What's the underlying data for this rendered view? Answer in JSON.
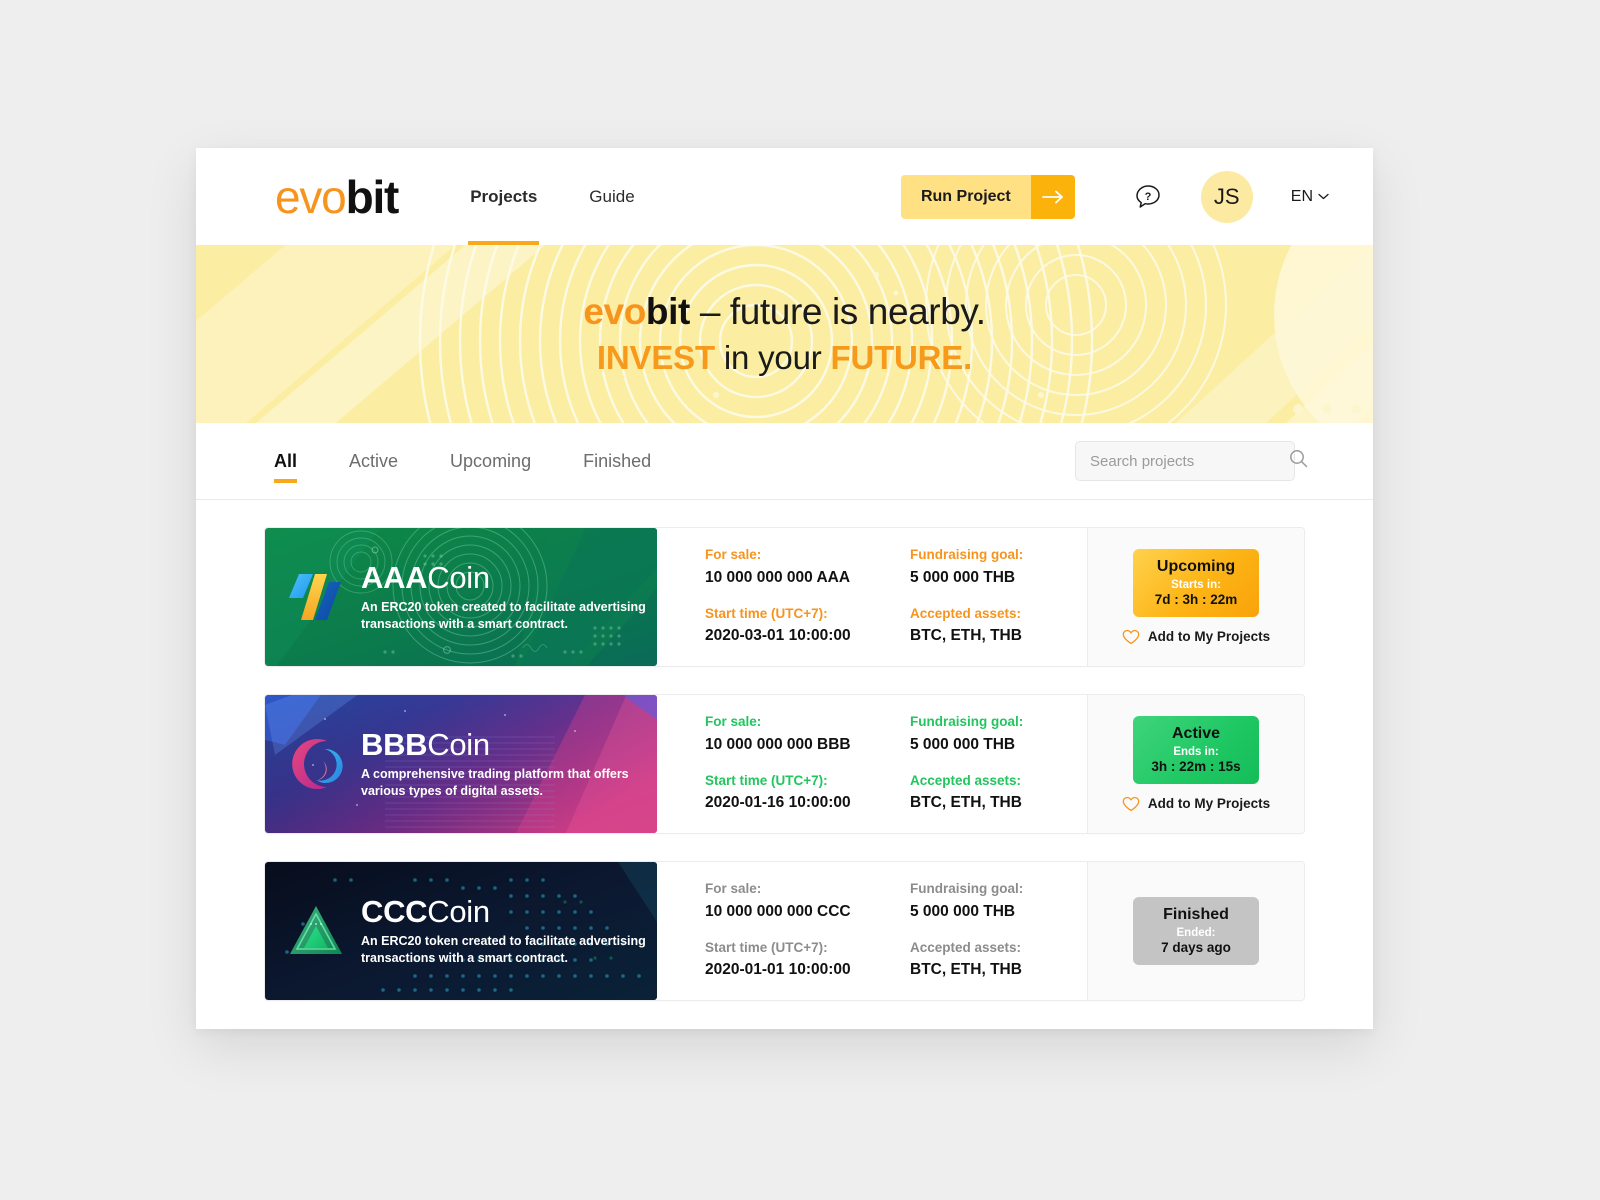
{
  "header": {
    "logo": {
      "part1": "evo",
      "part2": "bit"
    },
    "nav": [
      {
        "label": "Projects",
        "active": true
      },
      {
        "label": "Guide",
        "active": false
      }
    ],
    "run_button": "Run Project",
    "help_icon": "help-question-bubble-icon",
    "avatar_initials": "JS",
    "language": "EN"
  },
  "hero": {
    "line1_logo_a": "evo",
    "line1_logo_b": "bit",
    "line1_rest": " – future is nearby.",
    "line2_pre": "INVEST",
    "line2_mid": " in your ",
    "line2_post": "FUTURE."
  },
  "filters": {
    "tabs": [
      {
        "label": "All",
        "active": true
      },
      {
        "label": "Active",
        "active": false
      },
      {
        "label": "Upcoming",
        "active": false
      },
      {
        "label": "Finished",
        "active": false
      }
    ],
    "search_placeholder": "Search projects",
    "search_value": "",
    "search_icon": "search-icon"
  },
  "labels": {
    "for_sale": "For sale:",
    "fundraising_goal": "Fundraising goal:",
    "start_time": "Start time (UTC+7):",
    "accepted_assets": "Accepted assets:",
    "add_to_my_projects": "Add to My Projects"
  },
  "projects": [
    {
      "name_bold": "AAA",
      "name_rest": "Coin",
      "description": "An ERC20 token created to facilitate advertising transactions with a smart contract.",
      "for_sale": "10 000 000 000 AAA",
      "fundraising_goal": "5 000 000 THB",
      "start_time": "2020-03-01 10:00:00",
      "accepted_assets": "BTC, ETH, THB",
      "label_color": "#f7941e",
      "status": "Upcoming",
      "status_sub": "Starts in:",
      "status_time": "7d : 3h : 22m",
      "status_kind": "upcoming",
      "has_favorite": true
    },
    {
      "name_bold": "BBB",
      "name_rest": "Coin",
      "description": "A comprehensive trading platform that offers various types of digital assets.",
      "for_sale": "10 000 000 000 BBB",
      "fundraising_goal": "5 000 000 THB",
      "start_time": "2020-01-16 10:00:00",
      "accepted_assets": "BTC, ETH, THB",
      "label_color": "#22c55e",
      "status": "Active",
      "status_sub": "Ends in:",
      "status_time": "3h : 22m : 15s",
      "status_kind": "active",
      "has_favorite": true
    },
    {
      "name_bold": "CCC",
      "name_rest": "Coin",
      "description": "An ERC20 token created to facilitate advertising transactions with a smart contract.",
      "for_sale": "10 000 000 000 CCC",
      "fundraising_goal": "5 000 000 THB",
      "start_time": "2020-01-01 10:00:00",
      "accepted_assets": "BTC, ETH, THB",
      "label_color": "#8c8c8c",
      "status": "Finished",
      "status_sub": "Ended:",
      "status_time": "7 days ago",
      "status_kind": "finished",
      "has_favorite": false
    }
  ],
  "colors": {
    "brand_orange": "#f7941e",
    "accent_yellow": "#fbb20b",
    "active_green": "#22c55e",
    "finished_gray": "#c4c4c4",
    "hero_bg": "#fbeda2"
  }
}
